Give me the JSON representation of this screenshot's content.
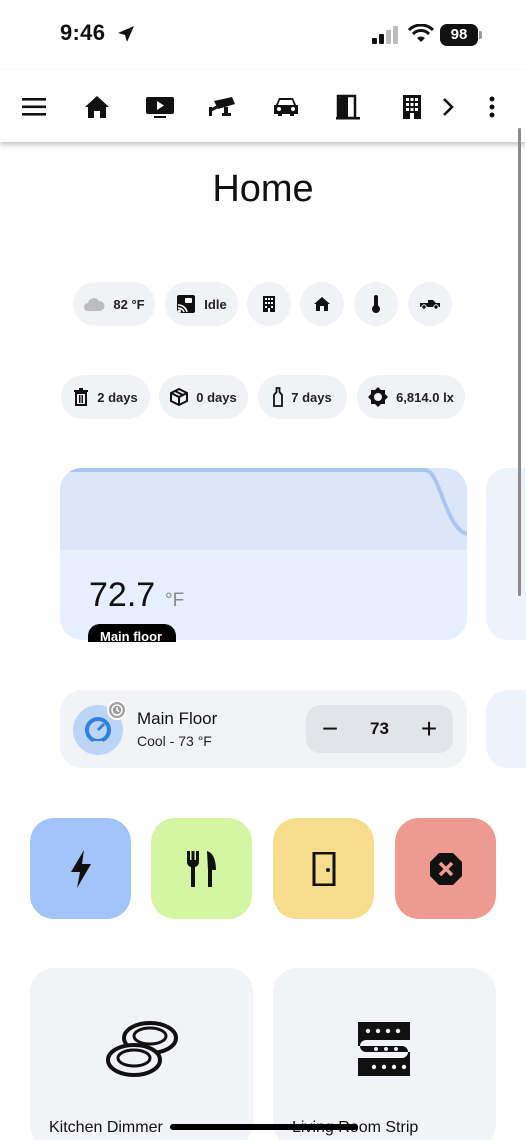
{
  "status_bar": {
    "time": "9:46",
    "battery": "98"
  },
  "page": {
    "title": "Home"
  },
  "badges_row1": [
    {
      "icon": "cloudy-icon",
      "text": "82 °F"
    },
    {
      "icon": "cast-icon",
      "text": "Idle"
    },
    {
      "icon": "building-icon",
      "text": ""
    },
    {
      "icon": "home-icon",
      "text": ""
    },
    {
      "icon": "thermometer-icon",
      "text": ""
    },
    {
      "icon": "pickup-truck-icon",
      "text": ""
    }
  ],
  "badges_row2": [
    {
      "icon": "trash-can-icon",
      "text": "2 days"
    },
    {
      "icon": "package-icon",
      "text": "0 days"
    },
    {
      "icon": "bottle-icon",
      "text": "7 days"
    },
    {
      "icon": "brightness-icon",
      "text": "6,814.0 lx"
    }
  ],
  "graph_card": {
    "value": "72.7",
    "unit": "°F",
    "label": "Main floor"
  },
  "thermostat": {
    "name": "Main Floor",
    "state": "Cool - 73 °F",
    "target": "73",
    "minus": "−",
    "plus": "+"
  },
  "quick_buttons": [
    {
      "icon": "lightning-icon",
      "color": "#a3c4f8"
    },
    {
      "icon": "silverware-icon",
      "color": "#d5f5a3"
    },
    {
      "icon": "door-icon",
      "color": "#f6dc8c"
    },
    {
      "icon": "close-octagon-icon",
      "color": "#ee9a90"
    }
  ],
  "tiles": [
    {
      "icon": "plates-icon",
      "label": "Kitchen Dimmer"
    },
    {
      "icon": "led-strip-icon",
      "label": "Living Room Strip"
    }
  ]
}
